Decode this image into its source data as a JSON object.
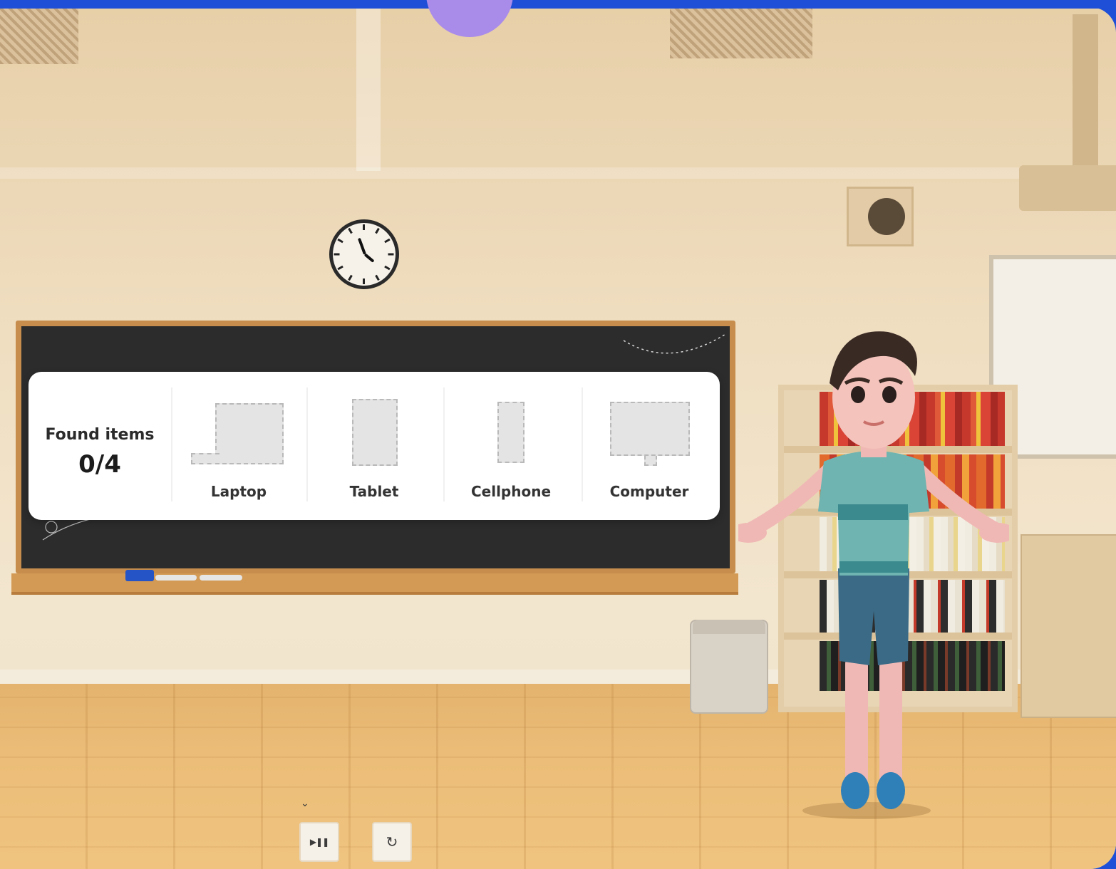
{
  "found_panel": {
    "label": "Found items",
    "found_count": 0,
    "total": 4,
    "count_text": "0/4",
    "items": [
      {
        "label": "Laptop",
        "icon": "laptop-placeholder-icon"
      },
      {
        "label": "Tablet",
        "icon": "tablet-placeholder-icon"
      },
      {
        "label": "Cellphone",
        "icon": "cellphone-placeholder-icon"
      },
      {
        "label": "Computer",
        "icon": "computer-placeholder-icon"
      }
    ]
  },
  "controls": {
    "expand_icon": "chevron-down-icon",
    "expand_glyph": "⌄",
    "play_pause_icon": "play-pause-icon",
    "play_pause_glyph": "▶❚❚",
    "restart_icon": "restart-icon",
    "restart_glyph": "↻"
  },
  "colors": {
    "accent": "#1e4fd6",
    "orb": "#a98be9",
    "board": "#2c2c2c"
  }
}
